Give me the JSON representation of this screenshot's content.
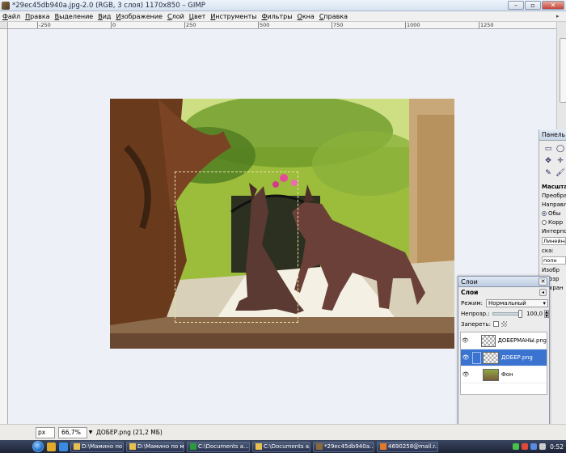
{
  "window": {
    "title": "*29ec45db940a.jpg-2.0 (RGB, 3 слоя) 1170x850 – GIMP"
  },
  "menu": [
    "Файл",
    "Правка",
    "Выделение",
    "Вид",
    "Изображение",
    "Слой",
    "Цвет",
    "Инструменты",
    "Фильтры",
    "Окна",
    "Справка"
  ],
  "ruler": {
    "top_labels": [
      "-250",
      "0",
      "250",
      "500",
      "750",
      "1000",
      "1250"
    ]
  },
  "toolbox": {
    "title": "Панель ин",
    "section": "Масштаб",
    "transform_label": "Преобразо",
    "direction_label": "Направлен",
    "option1": "Обы",
    "option2": "Корр",
    "interp_label": "Интерполя",
    "interp_value": "Линейная",
    "field1": "ска:",
    "field2": "полн",
    "field3": "Изобр",
    "field4": "прозр",
    "keep_label": "Сохран"
  },
  "layers_dialog": {
    "title": "Слои",
    "tab": "Слои",
    "mode_label": "Режим:",
    "mode_value": "Нормальный",
    "opacity_label": "Непрозр.:",
    "opacity_value": "100,0",
    "opacity_fraction": 1.0,
    "lock_label": "Запереть:",
    "layers": [
      {
        "name": "ДОБЕРМАНЫ.png",
        "visible": true,
        "active": false
      },
      {
        "name": "ДОБЕР.png",
        "visible": true,
        "active": true
      },
      {
        "name": "Фон",
        "visible": true,
        "active": false
      }
    ]
  },
  "statusbar": {
    "unit": "px",
    "zoom": "66,7%",
    "info": "ДОБЕР.png (21,2 МБ)"
  },
  "taskbar": {
    "tasks": [
      "D:\\Мамино по м...",
      "D:\\Мамино по м...",
      "C:\\Documents a...",
      "C:\\Documents a...",
      "*29ec45db940a...",
      "4690258@mail.r..."
    ],
    "clock": "0:52"
  },
  "colors": {
    "selection": "#3a74d0",
    "titlebar": "#d6e2f1",
    "taskbar": "#1c2336"
  }
}
